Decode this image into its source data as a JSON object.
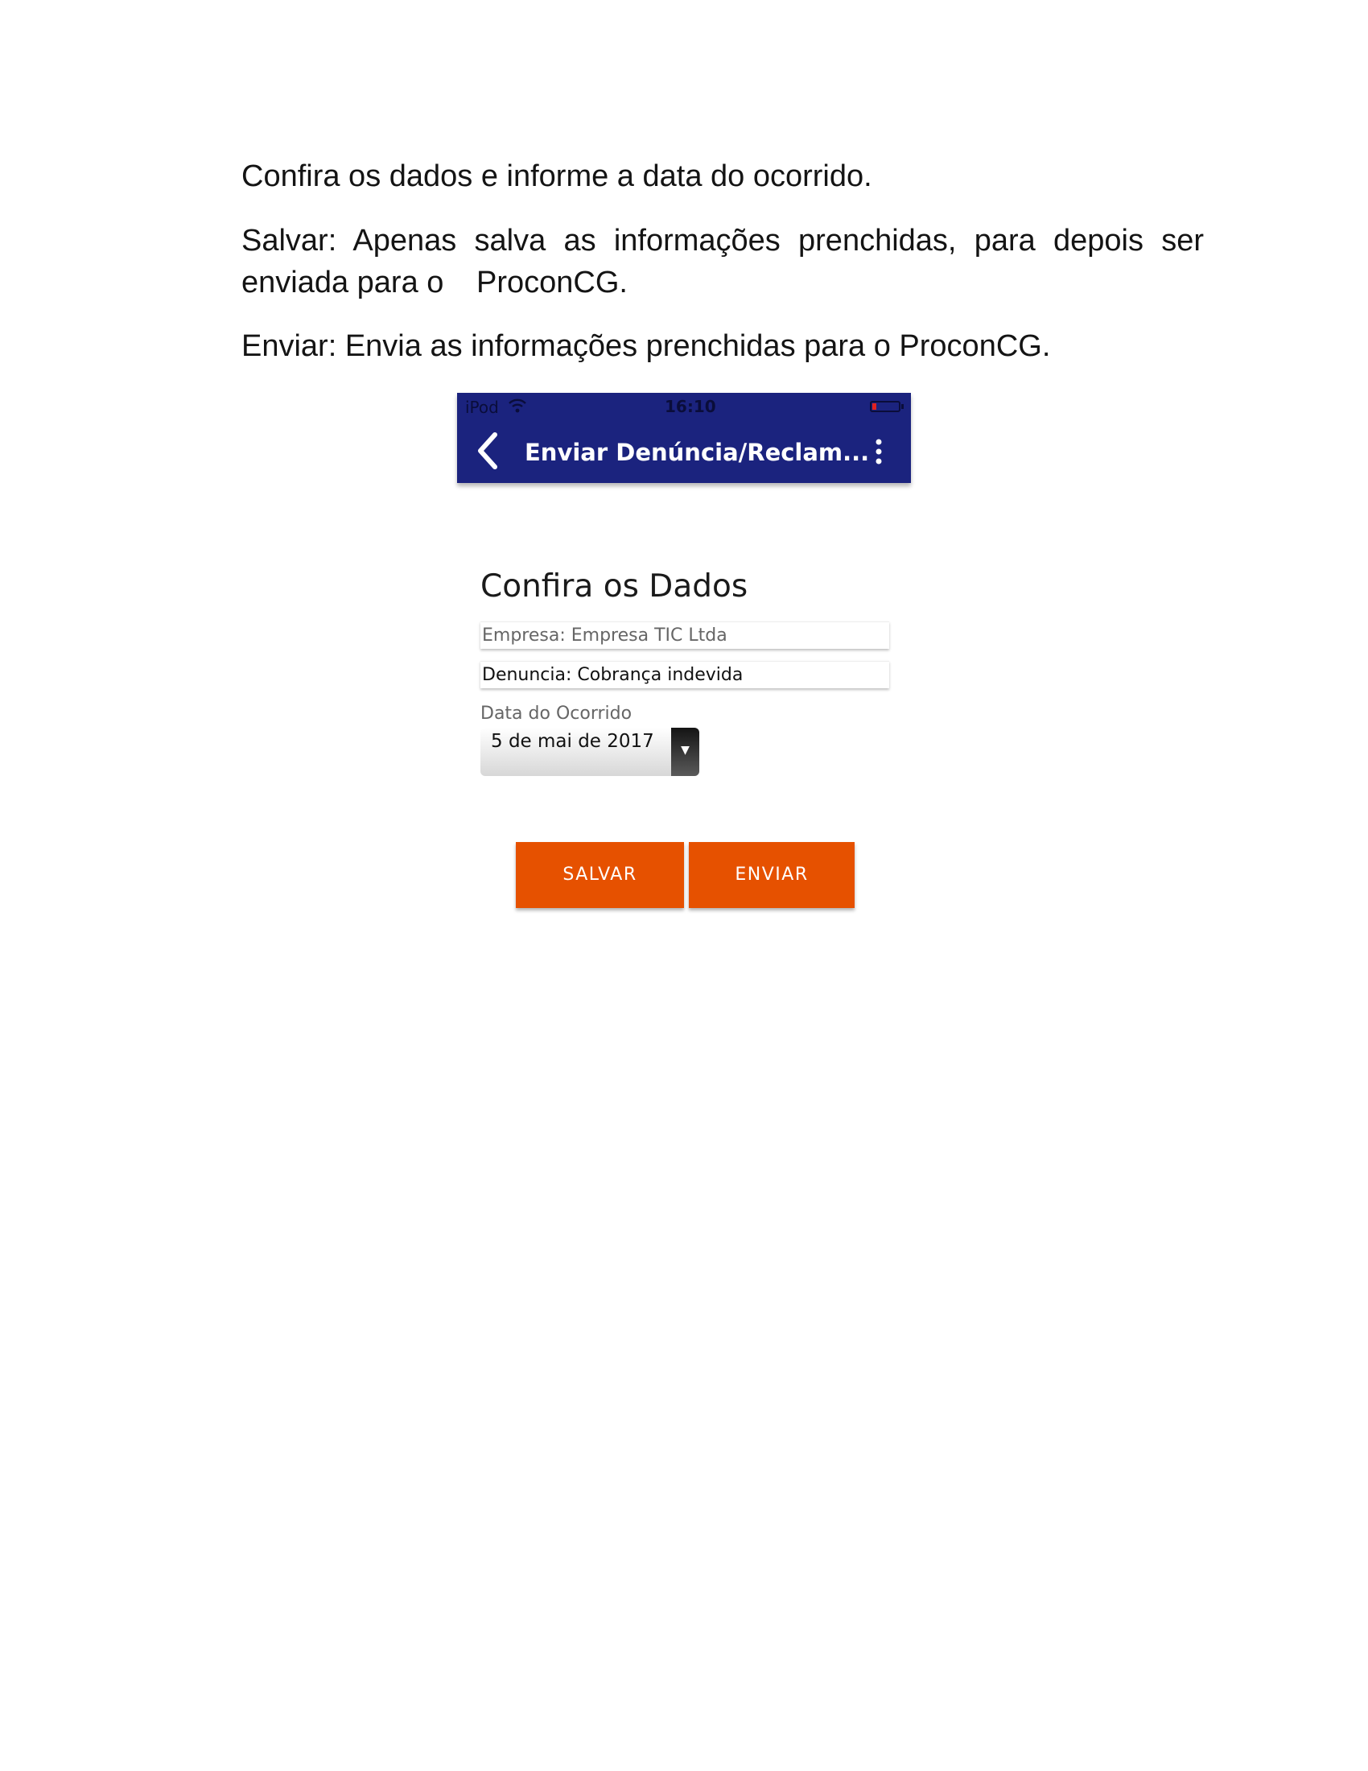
{
  "document": {
    "p1": "Confira os dados e informe a data do ocorrido.",
    "p2_part1": "Salvar: Apenas salva as informações prenchidas, para depois ser enviada para o",
    "p2_part2": "ProconCG.",
    "p3": "Enviar: Envia as informações prenchidas para o ProconCG."
  },
  "phone": {
    "status_bar": {
      "carrier": "iPod",
      "time": "16:10"
    },
    "app_bar": {
      "title": "Enviar Denúncia/Reclam..."
    },
    "form": {
      "title": "Confira os Dados",
      "empresa": "Empresa: Empresa TIC Ltda",
      "denuncia": "Denuncia: Cobrança indevida",
      "date_label": "Data do Ocorrido",
      "date_value": "5 de mai de 2017",
      "date_arrow": "▼"
    },
    "buttons": {
      "salvar": "SALVAR",
      "enviar": "ENVIAR"
    }
  },
  "colors": {
    "app_bar": "#1b237e",
    "button": "#e65100",
    "battery_low": "#e0211f"
  },
  "icons": [
    "wifi-icon",
    "battery-icon",
    "back-arrow-icon",
    "more-vert-icon",
    "dropdown-arrow-icon"
  ]
}
